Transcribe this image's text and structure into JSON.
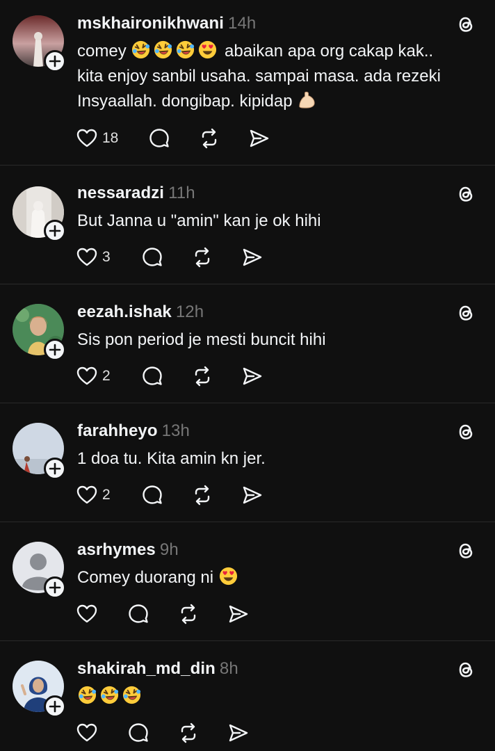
{
  "comments": [
    {
      "username": "mskhaironikhwani",
      "time": "14h",
      "text_before_emoji": "comey ",
      "emojis": [
        "rolling-laughing",
        "rolling-laughing",
        "rolling-laughing",
        "heart-eyes"
      ],
      "text_line1_rest": " abaikan apa org cakap kak..",
      "text_line2": "kita enjoy sanbil usaha. sampai masa. ada rezeki",
      "text_line3": "Insyaallah. dongibap. kipidap",
      "trailing_emoji": "flexed-biceps",
      "likes": "18"
    },
    {
      "username": "nessaradzi",
      "time": "11h",
      "text": "But Janna u \"amin\" kan je ok hihi",
      "likes": "3"
    },
    {
      "username": "eezah.ishak",
      "time": "12h",
      "text": "Sis pon period je mesti buncit hihi",
      "likes": "2"
    },
    {
      "username": "farahheyo",
      "time": "13h",
      "text": "1 doa tu. Kita amin kn jer.",
      "likes": "2"
    },
    {
      "username": "asrhymes",
      "time": "9h",
      "text": "Comey duorang ni",
      "trailing_emoji": "heart-eyes",
      "likes": ""
    },
    {
      "username": "shakirah_md_din",
      "time": "8h",
      "emojis": [
        "rolling-laughing",
        "rolling-laughing",
        "rolling-laughing"
      ],
      "likes": ""
    }
  ],
  "icons": {
    "like": "heart-icon",
    "reply": "comment-bubble-icon",
    "repost": "repost-icon",
    "share": "send-icon",
    "app": "threads-logo-icon",
    "follow": "plus-icon"
  },
  "colors": {
    "background": "#101010",
    "text": "#f3f5f7",
    "muted": "#777777",
    "divider": "#2a2a2a"
  }
}
